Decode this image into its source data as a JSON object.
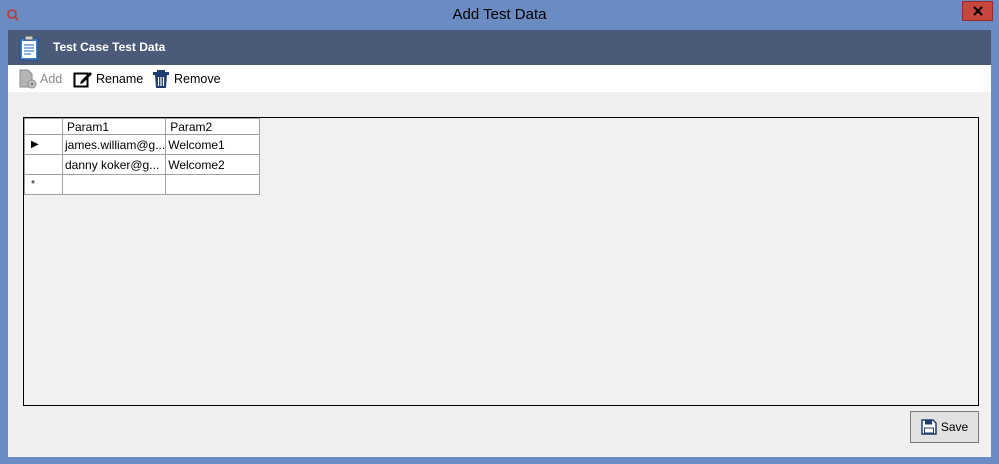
{
  "window": {
    "title": "Add Test Data",
    "close_glyph": "✕"
  },
  "header": {
    "title": "Test Case Test Data",
    "icon": "clipboard-icon"
  },
  "toolbar": {
    "add_label": "Add",
    "rename_label": "Rename",
    "remove_label": "Remove"
  },
  "grid": {
    "columns": [
      "Param1",
      "Param2"
    ],
    "rows": [
      {
        "marker": "▶",
        "cells": [
          "james.william@g...",
          "Welcome1"
        ]
      },
      {
        "marker": "",
        "cells": [
          "danny koker@g...",
          "Welcome2"
        ]
      },
      {
        "marker": "*",
        "cells": [
          "",
          ""
        ]
      }
    ]
  },
  "footer": {
    "save_label": "Save"
  },
  "colors": {
    "frame": "#6b8bc3",
    "header": "#4a5a78",
    "close": "#c7463d"
  }
}
